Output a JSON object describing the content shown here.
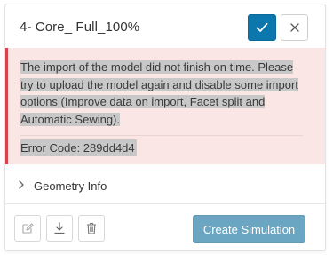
{
  "card": {
    "title": "4- Core_ Full_100%"
  },
  "error": {
    "lines": [
      "The import of the model did not finish on time. Please",
      "try to upload the model again and disable some import",
      "options (Improve data on import, Facet split and",
      "Automatic Sewing)."
    ],
    "code_label": "Error Code: 289dd4d4"
  },
  "geometry": {
    "label": "Geometry Info"
  },
  "footer": {
    "create_label": "Create Simulation"
  },
  "colors": {
    "accent": "#0c77ad",
    "create_button": "#6aa6c2",
    "error_bg": "#fbe6e6",
    "error_border": "#d9434b",
    "highlight": "#c8c8c8"
  },
  "icons": {
    "confirm": "check-icon",
    "close": "close-icon",
    "expand": "chevron-right-icon",
    "edit": "edit-icon",
    "download": "download-icon",
    "delete": "trash-icon"
  }
}
